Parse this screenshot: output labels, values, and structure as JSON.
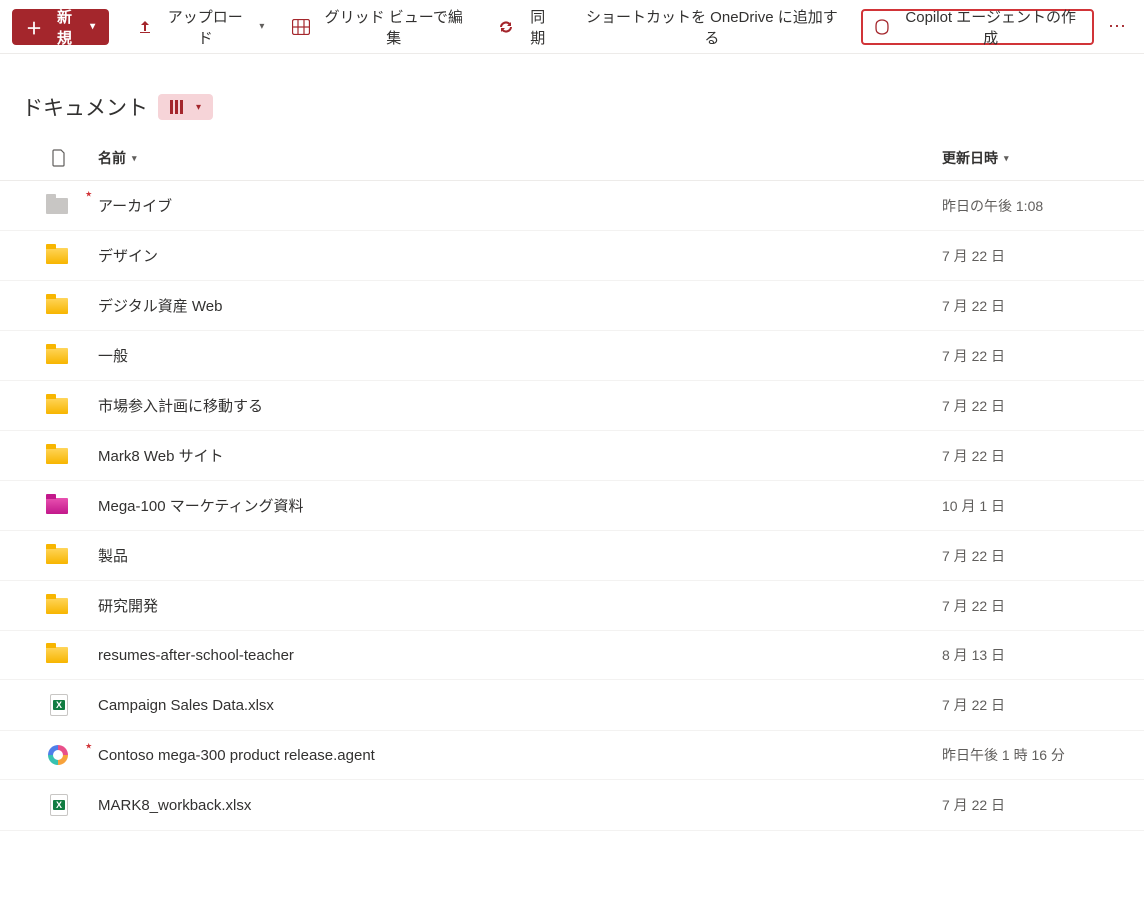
{
  "toolbar": {
    "new_label": "新規",
    "upload_label": "アップロード",
    "grid_edit_label": "グリッド ビューで編集",
    "sync_label": "同期",
    "shortcut_label": "ショートカットを OneDrive に追加する",
    "copilot_label": "Copilot エージェントの作成"
  },
  "title": "ドキュメント",
  "columns": {
    "name": "名前",
    "modified": "更新日時"
  },
  "items": [
    {
      "name": "アーカイブ",
      "modified": "昨日の午後 1:08",
      "icon": "folder-gray",
      "is_new": true
    },
    {
      "name": "デザイン",
      "modified": "7 月 22 日",
      "icon": "folder-yellow",
      "is_new": false
    },
    {
      "name": "デジタル資産 Web",
      "modified": "7 月 22 日",
      "icon": "folder-yellow",
      "is_new": false
    },
    {
      "name": "一般",
      "modified": "7 月 22 日",
      "icon": "folder-yellow",
      "is_new": false
    },
    {
      "name": "市場参入計画に移動する",
      "modified": "7 月 22 日",
      "icon": "folder-yellow",
      "is_new": false
    },
    {
      "name": "Mark8 Web サイト",
      "modified": "7 月 22 日",
      "icon": "folder-yellow",
      "is_new": false
    },
    {
      "name": "Mega-100 マーケティング資料",
      "modified": "10 月 1 日",
      "icon": "folder-pink",
      "is_new": false
    },
    {
      "name": "製品",
      "modified": "7 月 22 日",
      "icon": "folder-yellow",
      "is_new": false
    },
    {
      "name": "研究開発",
      "modified": "7 月 22 日",
      "icon": "folder-yellow",
      "is_new": false
    },
    {
      "name": "resumes-after-school-teacher",
      "modified": "8 月 13 日",
      "icon": "folder-yellow",
      "is_new": false
    },
    {
      "name": "Campaign Sales Data.xlsx",
      "modified": "7 月 22 日",
      "icon": "file-xlsx",
      "is_new": false
    },
    {
      "name": "Contoso mega-300 product release.agent",
      "modified": "昨日午後 1 時 16 分",
      "icon": "file-agent",
      "is_new": true
    },
    {
      "name": "MARK8_workback.xlsx",
      "modified": "7 月 22 日",
      "icon": "file-xlsx",
      "is_new": false
    }
  ]
}
